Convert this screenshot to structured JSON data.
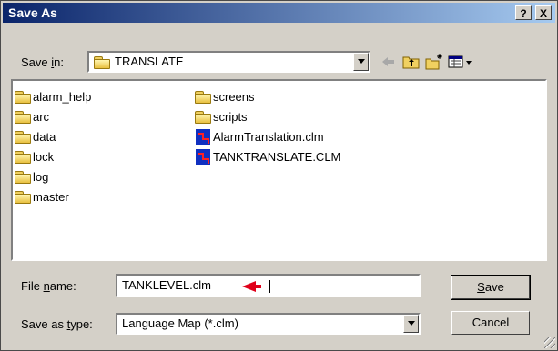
{
  "window": {
    "title": "Save As",
    "help_label": "?",
    "close_label": "X"
  },
  "toolbar": {
    "save_in_prefix": "Save ",
    "save_in_mnemonic": "i",
    "save_in_suffix": "n:",
    "current_folder": "TRANSLATE"
  },
  "files": [
    {
      "name": "alarm_help",
      "type": "folder"
    },
    {
      "name": "arc",
      "type": "folder"
    },
    {
      "name": "data",
      "type": "folder"
    },
    {
      "name": "lock",
      "type": "folder"
    },
    {
      "name": "log",
      "type": "folder"
    },
    {
      "name": "master",
      "type": "folder"
    },
    {
      "name": "screens",
      "type": "folder"
    },
    {
      "name": "scripts",
      "type": "folder"
    },
    {
      "name": "AlarmTranslation.clm",
      "type": "file"
    },
    {
      "name": "TANKTRANSLATE.CLM",
      "type": "file"
    }
  ],
  "filename": {
    "label_prefix": "File ",
    "label_mnemonic": "n",
    "label_suffix": "ame:",
    "value": "TANKLEVEL.clm"
  },
  "filetype": {
    "label_prefix": "Save as ",
    "label_mnemonic": "t",
    "label_suffix": "ype:",
    "value": "Language Map (*.clm)"
  },
  "buttons": {
    "save_mnemonic": "S",
    "save_rest": "ave",
    "cancel": "Cancel"
  },
  "colors": {
    "title_bar": "#0a246a",
    "dialog_bg": "#d4d0c8",
    "annotation_arrow": "#e0001a"
  }
}
